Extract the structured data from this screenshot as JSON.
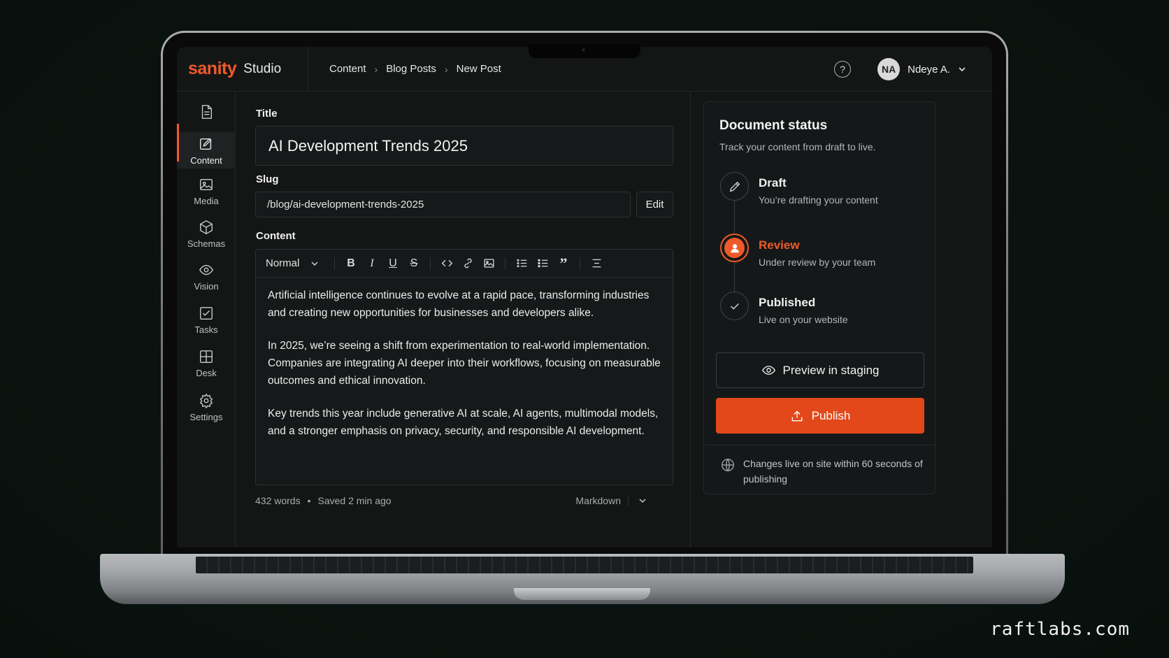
{
  "brand": {
    "logo": "sanity",
    "product": "Studio"
  },
  "breadcrumb": [
    "Content",
    "Blog Posts",
    "New Post"
  ],
  "user": {
    "initials": "NA",
    "name": "Ndeye A."
  },
  "sidebar": {
    "items": [
      {
        "label": "",
        "icon": "document-icon"
      },
      {
        "label": "Content",
        "icon": "edit-icon",
        "active": true
      },
      {
        "label": "Media",
        "icon": "image-icon"
      },
      {
        "label": "Schemas",
        "icon": "cube-icon"
      },
      {
        "label": "Vision",
        "icon": "eye-icon"
      },
      {
        "label": "Tasks",
        "icon": "checkbox-icon"
      },
      {
        "label": "Desk",
        "icon": "grid-icon"
      },
      {
        "label": "Settings",
        "icon": "gear-icon"
      }
    ]
  },
  "editor": {
    "title_label": "Title",
    "title_value": "AI Development Trends 2025",
    "slug_label": "Slug",
    "slug_value": "/blog/ai-development-trends-2025",
    "slug_edit": "Edit",
    "content_label": "Content",
    "block_style": "Normal",
    "paragraphs": [
      "Artificial intelligence continues to evolve at a rapid pace, transforming industries and creating new opportunities for businesses and developers alike.",
      "In 2025, we’re seeing a shift from experimentation to real-world implementation. Companies are integrating AI deeper into their workflows, focusing on measurable outcomes and ethical innovation.",
      "Key trends this year include generative AI at scale, AI agents, multimodal models, and a stronger emphasis on privacy, security, and responsible AI development."
    ],
    "footer": {
      "words": "432 words",
      "saved": "Saved 2 min ago",
      "format": "Markdown"
    }
  },
  "status": {
    "title": "Document status",
    "subtitle": "Track your content from draft to live.",
    "steps": [
      {
        "title": "Draft",
        "desc": "You’re drafting your content",
        "icon": "pencil-icon"
      },
      {
        "title": "Review",
        "desc": "Under review by your team",
        "icon": "user-icon",
        "active": true
      },
      {
        "title": "Published",
        "desc": "Live on your website",
        "icon": "check-icon"
      }
    ],
    "preview_label": "Preview in staging",
    "publish_label": "Publish",
    "note": "Changes live on site within 60 seconds of publishing"
  },
  "colors": {
    "accent": "#ef5a2b",
    "publish": "#e3481a",
    "background": "#141616"
  },
  "watermark": "raftlabs.com"
}
